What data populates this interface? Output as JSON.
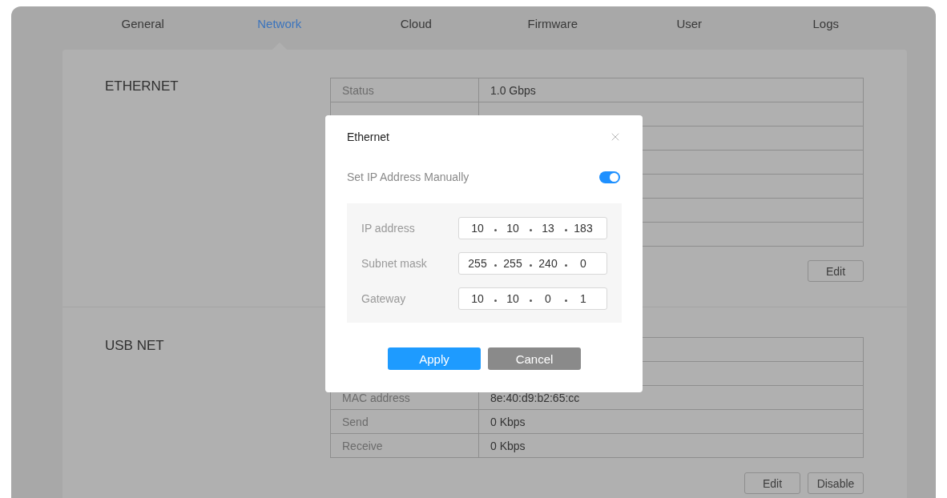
{
  "tabs": [
    {
      "label": "General",
      "selected": false
    },
    {
      "label": "Network",
      "selected": true
    },
    {
      "label": "Cloud",
      "selected": false
    },
    {
      "label": "Firmware",
      "selected": false
    },
    {
      "label": "User",
      "selected": false
    },
    {
      "label": "Logs",
      "selected": false
    }
  ],
  "sections": [
    {
      "title": "ETHERNET",
      "rows": [
        {
          "label": "Status",
          "value": "1.0 Gbps"
        }
      ],
      "buttons": [
        "Edit"
      ]
    },
    {
      "title": "USB NET",
      "rows": [
        {
          "label": "MAC address",
          "value": "8e:40:d9:b2:65:cc"
        },
        {
          "label": "Send",
          "value": "0 Kbps"
        },
        {
          "label": "Receive",
          "value": "0 Kbps"
        }
      ],
      "buttons": [
        "Edit",
        "Disable"
      ]
    }
  ],
  "dialog": {
    "title": "Ethernet",
    "toggle": {
      "label": "Set IP Address Manually",
      "on": true
    },
    "fields": [
      {
        "label": "IP address",
        "octets": [
          "10",
          "10",
          "13",
          "183"
        ]
      },
      {
        "label": "Subnet mask",
        "octets": [
          "255",
          "255",
          "240",
          "0"
        ]
      },
      {
        "label": "Gateway",
        "octets": [
          "10",
          "10",
          "0",
          "1"
        ]
      }
    ],
    "buttons": [
      {
        "label": "Apply",
        "kind": "primary"
      },
      {
        "label": "Cancel",
        "kind": "secondary"
      }
    ]
  }
}
